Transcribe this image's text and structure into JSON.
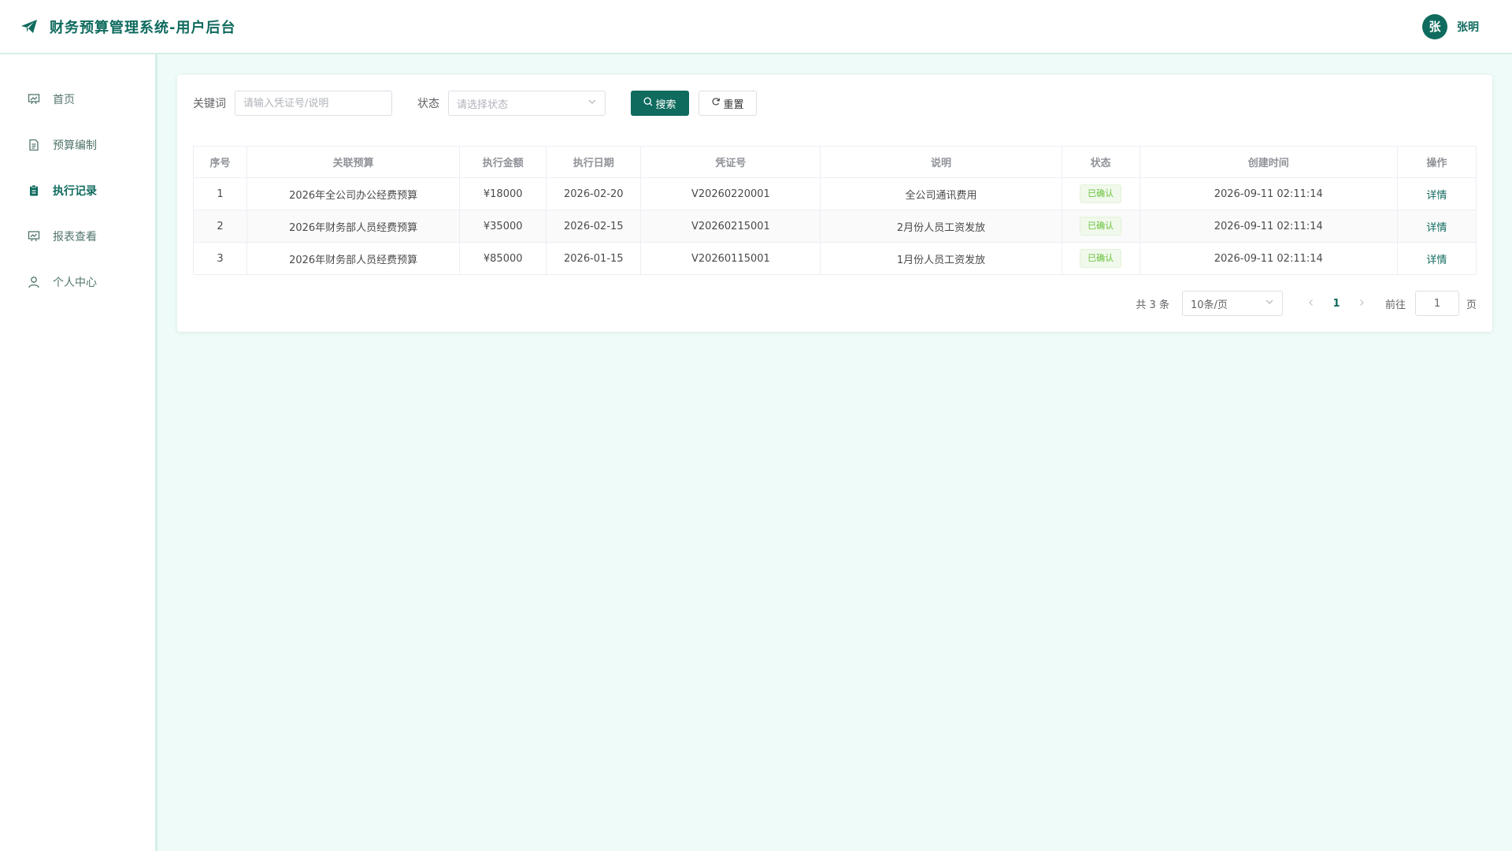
{
  "header": {
    "title": "财务预算管理系统-用户后台",
    "user_avatar": "张",
    "user_name": "张明"
  },
  "sidebar": {
    "items": [
      {
        "label": "首页",
        "icon": "presentation-icon"
      },
      {
        "label": "预算编制",
        "icon": "document-icon"
      },
      {
        "label": "执行记录",
        "icon": "clipboard-icon",
        "active": true
      },
      {
        "label": "报表查看",
        "icon": "chart-board-icon"
      },
      {
        "label": "个人中心",
        "icon": "user-icon"
      }
    ]
  },
  "filters": {
    "keyword_label": "关键词",
    "keyword_placeholder": "请输入凭证号/说明",
    "status_label": "状态",
    "status_placeholder": "请选择状态",
    "search_label": "搜索",
    "reset_label": "重置"
  },
  "table": {
    "columns": [
      "序号",
      "关联预算",
      "执行金额",
      "执行日期",
      "凭证号",
      "说明",
      "状态",
      "创建时间",
      "操作"
    ],
    "rows": [
      {
        "index": "1",
        "budget": "2026年全公司办公经费预算",
        "amount": "¥18000",
        "date": "2026-02-20",
        "voucher": "V20260220001",
        "desc": "全公司通讯费用",
        "status": "已确认",
        "created": "2026-09-11 02:11:14",
        "action": "详情"
      },
      {
        "index": "2",
        "budget": "2026年财务部人员经费预算",
        "amount": "¥35000",
        "date": "2026-02-15",
        "voucher": "V20260215001",
        "desc": "2月份人员工资发放",
        "status": "已确认",
        "created": "2026-09-11 02:11:14",
        "action": "详情"
      },
      {
        "index": "3",
        "budget": "2026年财务部人员经费预算",
        "amount": "¥85000",
        "date": "2026-01-15",
        "voucher": "V20260115001",
        "desc": "1月份人员工资发放",
        "status": "已确认",
        "created": "2026-09-11 02:11:14",
        "action": "详情"
      }
    ]
  },
  "pagination": {
    "total": "共 3 条",
    "page_size": "10条/页",
    "current_page": "1",
    "goto_label": "前往",
    "goto_value": "1",
    "goto_suffix": "页"
  },
  "colors": {
    "accent": "#0f6b5e",
    "background": "#eefbf8",
    "status_success": "#67c23a"
  }
}
